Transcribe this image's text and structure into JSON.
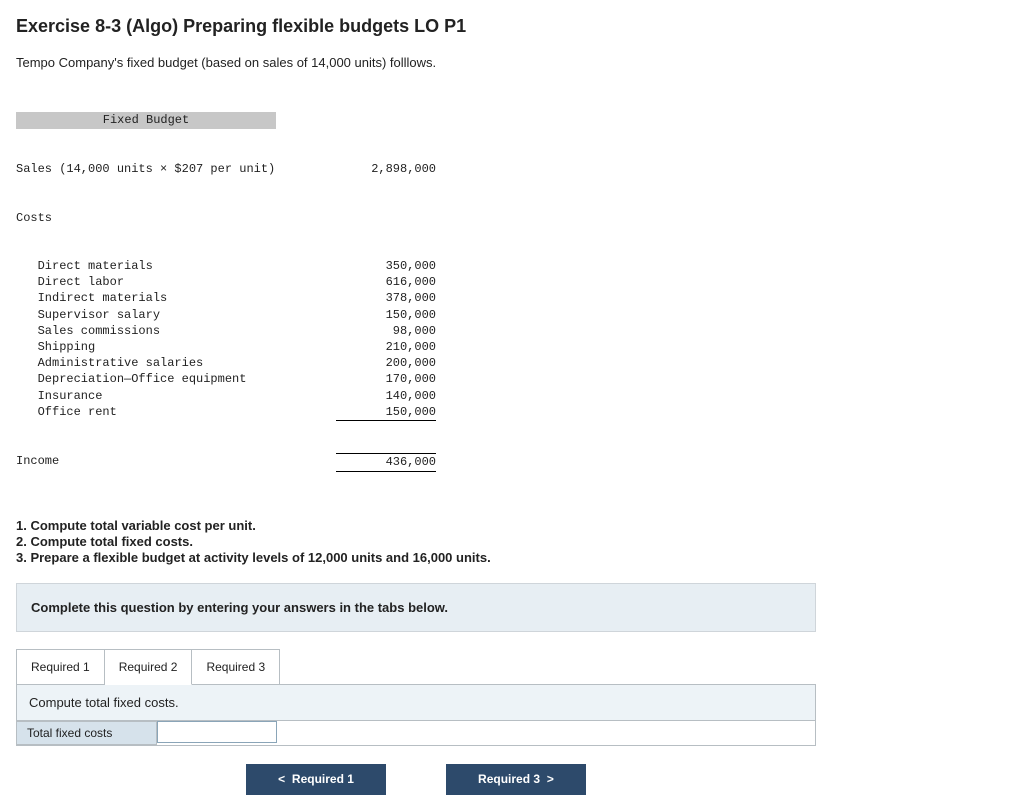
{
  "title": "Exercise 8-3 (Algo) Preparing flexible budgets LO P1",
  "intro": "Tempo Company's fixed budget (based on sales of 14,000 units) folllows.",
  "budget": {
    "header": "Fixed Budget",
    "sales_label": "Sales (14,000 units × $207 per unit)",
    "sales_value": "2,898,000",
    "costs_label": "Costs",
    "lines": [
      {
        "label": "Direct materials",
        "value": "350,000"
      },
      {
        "label": "Direct labor",
        "value": "616,000"
      },
      {
        "label": "Indirect materials",
        "value": "378,000"
      },
      {
        "label": "Supervisor salary",
        "value": "150,000"
      },
      {
        "label": "Sales commissions",
        "value": "98,000"
      },
      {
        "label": "Shipping",
        "value": "210,000"
      },
      {
        "label": "Administrative salaries",
        "value": "200,000"
      },
      {
        "label": "Depreciation—Office equipment",
        "value": "170,000"
      },
      {
        "label": "Insurance",
        "value": "140,000"
      },
      {
        "label": "Office rent",
        "value": "150,000"
      }
    ],
    "income_label": "Income",
    "income_value": "436,000"
  },
  "tasks": {
    "t1": "1. Compute total variable cost per unit.",
    "t2": "2. Compute total fixed costs.",
    "t3": "3. Prepare a flexible budget at activity levels of 12,000 units and 16,000 units."
  },
  "qprompt": "Complete this question by entering your answers in the tabs below.",
  "tabs": {
    "r1": "Required 1",
    "r2": "Required 2",
    "r3": "Required 3"
  },
  "panel": {
    "heading": "Compute total fixed costs.",
    "row_label": "Total fixed costs",
    "input_value": ""
  },
  "nav": {
    "prev_chev": "<",
    "prev": "Required 1",
    "next": "Required 3",
    "next_chev": ">"
  }
}
